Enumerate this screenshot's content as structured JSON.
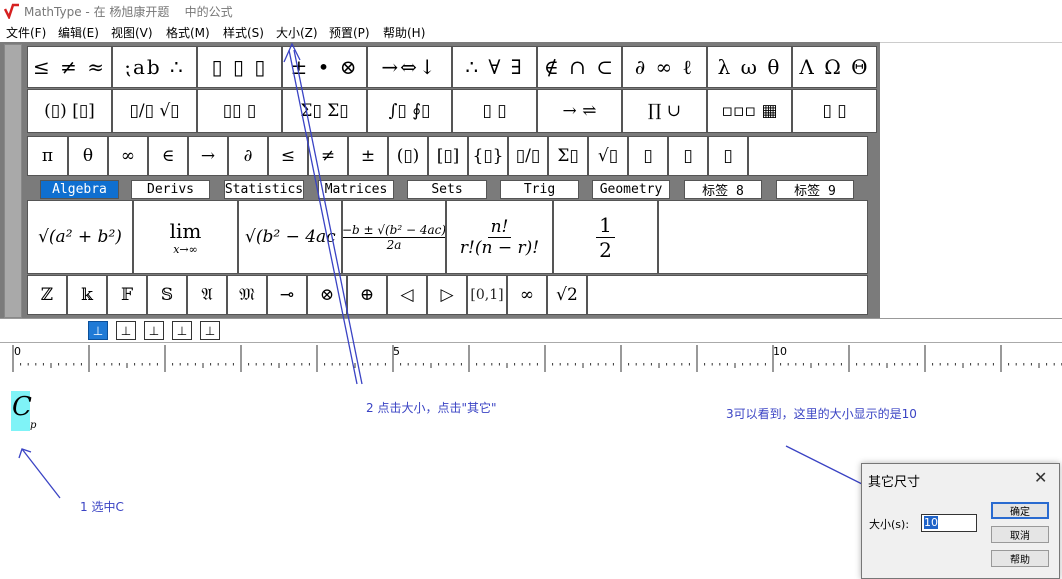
{
  "window": {
    "app_name": "MathType",
    "title_rest": "- 在 杨旭康开题    中的公式"
  },
  "menu": [
    {
      "label": "文件(F)"
    },
    {
      "label": "编辑(E)"
    },
    {
      "label": "视图(V)"
    },
    {
      "label": "格式(M)"
    },
    {
      "label": "样式(S)"
    },
    {
      "label": "大小(Z)"
    },
    {
      "label": "预置(P)"
    },
    {
      "label": "帮助(H)"
    }
  ],
  "palette_row1": [
    "≤ ≠ ≈",
    "⁏ab ∴",
    "▯ ▯ ▯",
    "± • ⊗",
    "→⇔↓",
    "∴ ∀ ∃",
    "∉ ∩ ⊂",
    "∂ ∞ ℓ",
    "λ ω θ",
    "Λ Ω Θ"
  ],
  "palette_row2": [
    "(▯) [▯]",
    "▯/▯ √▯",
    "▯▯ ▯",
    "Σ▯ Σ▯",
    "∫▯ ∮▯",
    "▯ ▯",
    "→ ⇌",
    "∏ ∪",
    "▫▫▫ ▦",
    "▯ ▯"
  ],
  "palette_row3": [
    "π",
    "θ",
    "∞",
    "∈",
    "→",
    "∂",
    "≤",
    "≠",
    "±",
    "(▯)",
    "[▯]",
    "{▯}",
    "▯/▯",
    "Σ▯",
    "√▯",
    "▯",
    "▯",
    "▯"
  ],
  "tabs": [
    {
      "label": "Algebra"
    },
    {
      "label": "Derivs"
    },
    {
      "label": "Statistics"
    },
    {
      "label": "Matrices"
    },
    {
      "label": "Sets"
    },
    {
      "label": "Trig"
    },
    {
      "label": "Geometry"
    },
    {
      "label": "标签 8"
    },
    {
      "label": "标签 9"
    }
  ],
  "templates": {
    "sqrt_sum": "√(a² + b²)",
    "lim": "lim",
    "lim_sub": "x→∞",
    "sqrt_disc": "√(b² − 4ac",
    "quad_num": "−b ± √(b² − 4ac)",
    "quad_den": "2a",
    "binom_num": "n!",
    "binom_den": "r!(n − r)!",
    "half_num": "1",
    "half_den": "2"
  },
  "palette_row5": [
    "ℤ",
    "𝕜",
    "𝔽",
    "𝕊",
    "𝔄",
    "𝔐",
    "⊸",
    "⊗",
    "⊕",
    "◁",
    "▷",
    "[0,1]",
    "∞",
    "√2"
  ],
  "align_buttons": [
    "⊥",
    "⊥",
    "⊥",
    "⊥",
    "⊥"
  ],
  "ruler": {
    "marks": [
      "0",
      "5",
      "10"
    ]
  },
  "editor": {
    "symbol": "C",
    "subscript": "p"
  },
  "annotations": {
    "step1": "1 选中C",
    "step2": "2 点击大小，点击\"其它\"",
    "step3": "3可以看到，这里的大小显示的是10"
  },
  "dialog": {
    "title": "其它尺寸",
    "close": "✕",
    "size_label": "大小(s):",
    "size_value": "10",
    "ok": "确定",
    "cancel": "取消",
    "help": "帮助"
  },
  "colors": {
    "annotation": "#3a43c4",
    "selection": "#7ff3f7",
    "active_tab": "#0f6fd0"
  }
}
